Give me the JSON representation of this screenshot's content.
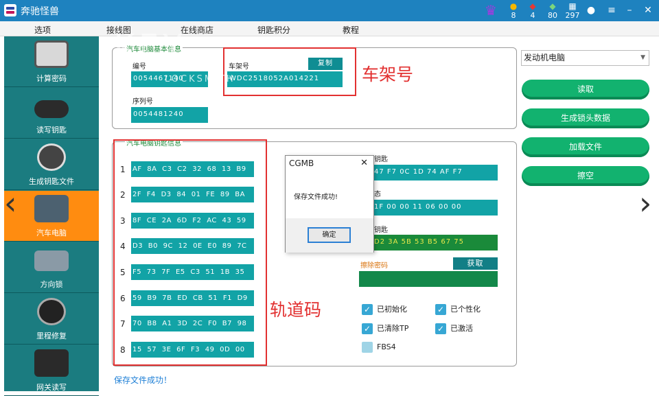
{
  "app": {
    "title": "奔驰怪兽",
    "stats": [
      {
        "icon": "coin-icon",
        "color": "#f5b800",
        "value": "8"
      },
      {
        "icon": "ruby-icon",
        "color": "#e53935",
        "value": "4"
      },
      {
        "icon": "gem-icon",
        "color": "#7cd67c",
        "value": "80"
      },
      {
        "icon": "calendar-icon",
        "color": "#ffffff",
        "value": "297"
      }
    ]
  },
  "menu": [
    "选项",
    "接线图",
    "在线商店",
    "钥匙积分",
    "教程"
  ],
  "sidebar": [
    "计算密码",
    "读写钥匙",
    "生成钥匙文件",
    "汽车电脑",
    "方向锁",
    "里程修复",
    "网关读写"
  ],
  "basic": {
    "title": "汽车电脑基本信息",
    "id_label": "编号",
    "id_value": "0054467140",
    "vin_label": "车架号",
    "vin_value": "WDC2518052A014221",
    "copy": "复制",
    "serial_label": "序列号",
    "serial_value": "0054481240"
  },
  "keys": {
    "title": "汽车电脑钥匙信息",
    "rows": [
      {
        "num": "1",
        "val": "AF 8A C3 C2 32 68 13 B9"
      },
      {
        "num": "2",
        "val": "2F F4 D3 84 01 FE 89 BA"
      },
      {
        "num": "3",
        "val": "8F CE 2A 6D F2 AC 43 59"
      },
      {
        "num": "4",
        "val": "D3 B0 9C 12 0E E0 89 7C"
      },
      {
        "num": "5",
        "val": "F5 73 7F E5 C3 51 1B 35"
      },
      {
        "num": "6",
        "val": "59 B9 7B ED CB 51 F1 D9"
      },
      {
        "num": "7",
        "val": "70 B8 A1 3D 2C F0 B7 98"
      },
      {
        "num": "8",
        "val": "15 57 3E 6F F3 49 0D 00"
      }
    ]
  },
  "right": {
    "label1": "钥匙",
    "val1": "47 F7 0C 1D 74 AF F7",
    "label2": "态",
    "val2": "1F 00 00 11 06 00 00",
    "label3": "钥匙",
    "val3": "D2 3A 5B 53 B5 67 75",
    "erase_label": "擦除密码",
    "fetch": "获取"
  },
  "checks": [
    {
      "label": "已初始化",
      "checked": true
    },
    {
      "label": "已个性化",
      "checked": true
    },
    {
      "label": "已清除TP",
      "checked": true
    },
    {
      "label": "已激活",
      "checked": true
    },
    {
      "label": "FBS4",
      "checked": false
    }
  ],
  "select": "发动机电脑",
  "buttons": [
    "读取",
    "生成锁头数据",
    "加载文件",
    "擦空"
  ],
  "dialog": {
    "title": "CGMB",
    "message": "保存文件成功!",
    "ok": "确定"
  },
  "status": "保存文件成功！",
  "annotations": {
    "vin": "车架号",
    "track": "轨道码"
  },
  "watermark": "KEY",
  "watermark_sub": "LOCKSMITH"
}
